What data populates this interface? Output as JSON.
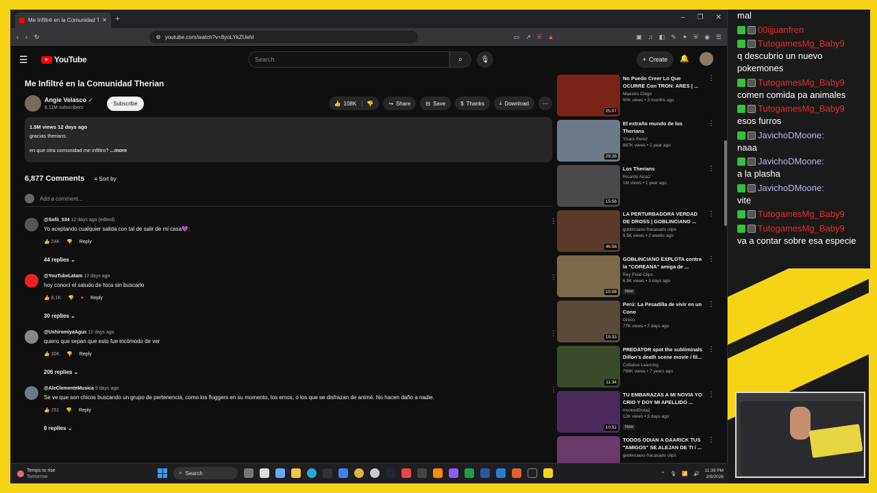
{
  "browser": {
    "tab_title": "Me Infiltré en la Comunidad The",
    "url": "youtube.com/watch?v=8yoLYkZUehl",
    "new_tab": "+",
    "window_controls": [
      "–",
      "❐",
      "✕"
    ]
  },
  "youtube": {
    "logo": "YouTube",
    "search_placeholder": "Search",
    "create_label": "Create"
  },
  "video": {
    "title": "Me Infiltré en la Comunidad Therian",
    "channel": "Angie Velasco",
    "subscribers": "6.11M subscribers",
    "subscribe_label": "Subscribe",
    "likes": "108K",
    "share_label": "Share",
    "save_label": "Save",
    "thanks_label": "Thanks",
    "download_label": "Download",
    "desc_stats": "1.5M views  12 days ago",
    "desc_line1": "gracias therians.",
    "desc_line2": "en que otra comunidad me infiltro? ",
    "desc_more": "...more"
  },
  "comments_section": {
    "count": "6,877 Comments",
    "sort_label": "Sort by",
    "add_placeholder": "Add a comment...",
    "reply_label": "Reply",
    "items": [
      {
        "author": "@Sofii_534",
        "time": "12 days ago (edited)",
        "text": "Yo aceptando cualquier salida con tal de salir de mi casa💜:",
        "likes": "24K",
        "replies": "44 replies"
      },
      {
        "author": "@YouTubeLatam",
        "time": "12 days ago",
        "text": "hoy conocí el saludo de foca sin buscarlo",
        "likes": "8.1K",
        "replies": "30 replies"
      },
      {
        "author": "@UshiromiyaAgus",
        "time": "12 days ago",
        "text": "quiero que sepan que esto fue incómodo de ver",
        "likes": "30K",
        "replies": "206 replies"
      },
      {
        "author": "@AleClementeMusica",
        "time": "5 days ago",
        "text": "Se ve que son chicos buscando un grupo de pertenencia, como los floggers en su momento, los emos, o los que se disfrazan de animé. No hacen daño a nadie.",
        "likes": "251",
        "replies": "6 replies"
      }
    ]
  },
  "sidebar": {
    "items": [
      {
        "title": "No Puedo Creer Lo Que OCURRE Con TRON: ARES | ...",
        "channel": "Maestro Ciego",
        "views": "90K views • 3 months ago",
        "duration": "25:07",
        "color": "#7a2418"
      },
      {
        "title": "El extraño mundo de los Therians",
        "channel": "Yisani Perez",
        "views": "887K views • 1 year ago",
        "duration": "29:28",
        "color": "#6d7a8a"
      },
      {
        "title": "Los Therians",
        "channel": "Ricardo Alca2",
        "views": "1M views • 1 year ago",
        "duration": "15:56",
        "color": "#4a4a4a"
      },
      {
        "title": "LA PERTURBADORA VERDAD DE DROSS | GOBLINCIANO ...",
        "channel": "goblinciano fracasado clips",
        "views": "9.5K views • 2 weeks ago",
        "duration": "46:56",
        "color": "#5a3a2a"
      },
      {
        "title": "GOBLINCIANO EXPLOTA contra la \"COREANA\" amiga de ...",
        "channel": "Rey Pixie Clips",
        "views": "6.9K views • 3 days ago",
        "duration": "10:08",
        "new": "New",
        "color": "#7a6a4a"
      },
      {
        "title": "Perú: La Pesadilla de vivir en un Cono",
        "channel": "Greco",
        "views": "77K views • 7 days ago",
        "duration": "19:33",
        "color": "#5a4a3a"
      },
      {
        "title": "PREDATOR spot the subliminals Dillon's death scene movie / fil...",
        "channel": "Collative Learning",
        "views": "788K views • 7 years ago",
        "duration": "11:34",
        "color": "#3a4a2a"
      },
      {
        "title": "TU EMBARAZAS A MI NOVIA YO CRIO Y DOY MI APELLIDO ...",
        "channel": "invokedDota2",
        "views": "12K views • 3 days ago",
        "duration": "10:52",
        "new": "New",
        "color": "#4a2a5a"
      },
      {
        "title": "TODOS ODIAN A DAARICK TUS \"AMIGOS\" SE ALEJAN DE TI / ...",
        "channel": "goblinciano fracasado clips",
        "views": "",
        "duration": "",
        "color": "#6a3a6a"
      }
    ]
  },
  "taskbar": {
    "weather_line1": "Temps to rise",
    "weather_line2": "Tomorrow",
    "search_label": "Search",
    "time": "11:39 PM",
    "date": "2/8/2026"
  },
  "chat": {
    "lines": [
      {
        "user": "",
        "text": "mal",
        "color": "#ffffff"
      },
      {
        "user": "00ijjuanfren",
        "text": "",
        "color": "#e0302a"
      },
      {
        "user": "TutogamesMg_Baby9",
        "text": "q descubrio un nuevo pokemones",
        "color": "#e0302a"
      },
      {
        "user": "TutogamesMg_Baby9",
        "text": "comen comida pa animales",
        "color": "#e0302a"
      },
      {
        "user": "TutogamesMg_Baby9",
        "text": "esos furros",
        "color": "#e0302a"
      },
      {
        "user": "JavichoDMoone:",
        "text": "naaa",
        "color": "#b6b6f0"
      },
      {
        "user": "JavichoDMoone:",
        "text": "a la plasha",
        "color": "#b6b6f0"
      },
      {
        "user": "JavichoDMoone:",
        "text": "vite",
        "color": "#b6b6f0"
      },
      {
        "user": "TutogamesMg_Baby9",
        "text": "",
        "color": "#e0302a"
      },
      {
        "user": "TutogamesMg_Baby9",
        "text": "va a contar sobre esa especie",
        "color": "#e0302a"
      }
    ]
  },
  "colors": {
    "accent_yellow": "#f5d417",
    "youtube_red": "#ff0000",
    "page_bg": "#0f0f0f"
  }
}
